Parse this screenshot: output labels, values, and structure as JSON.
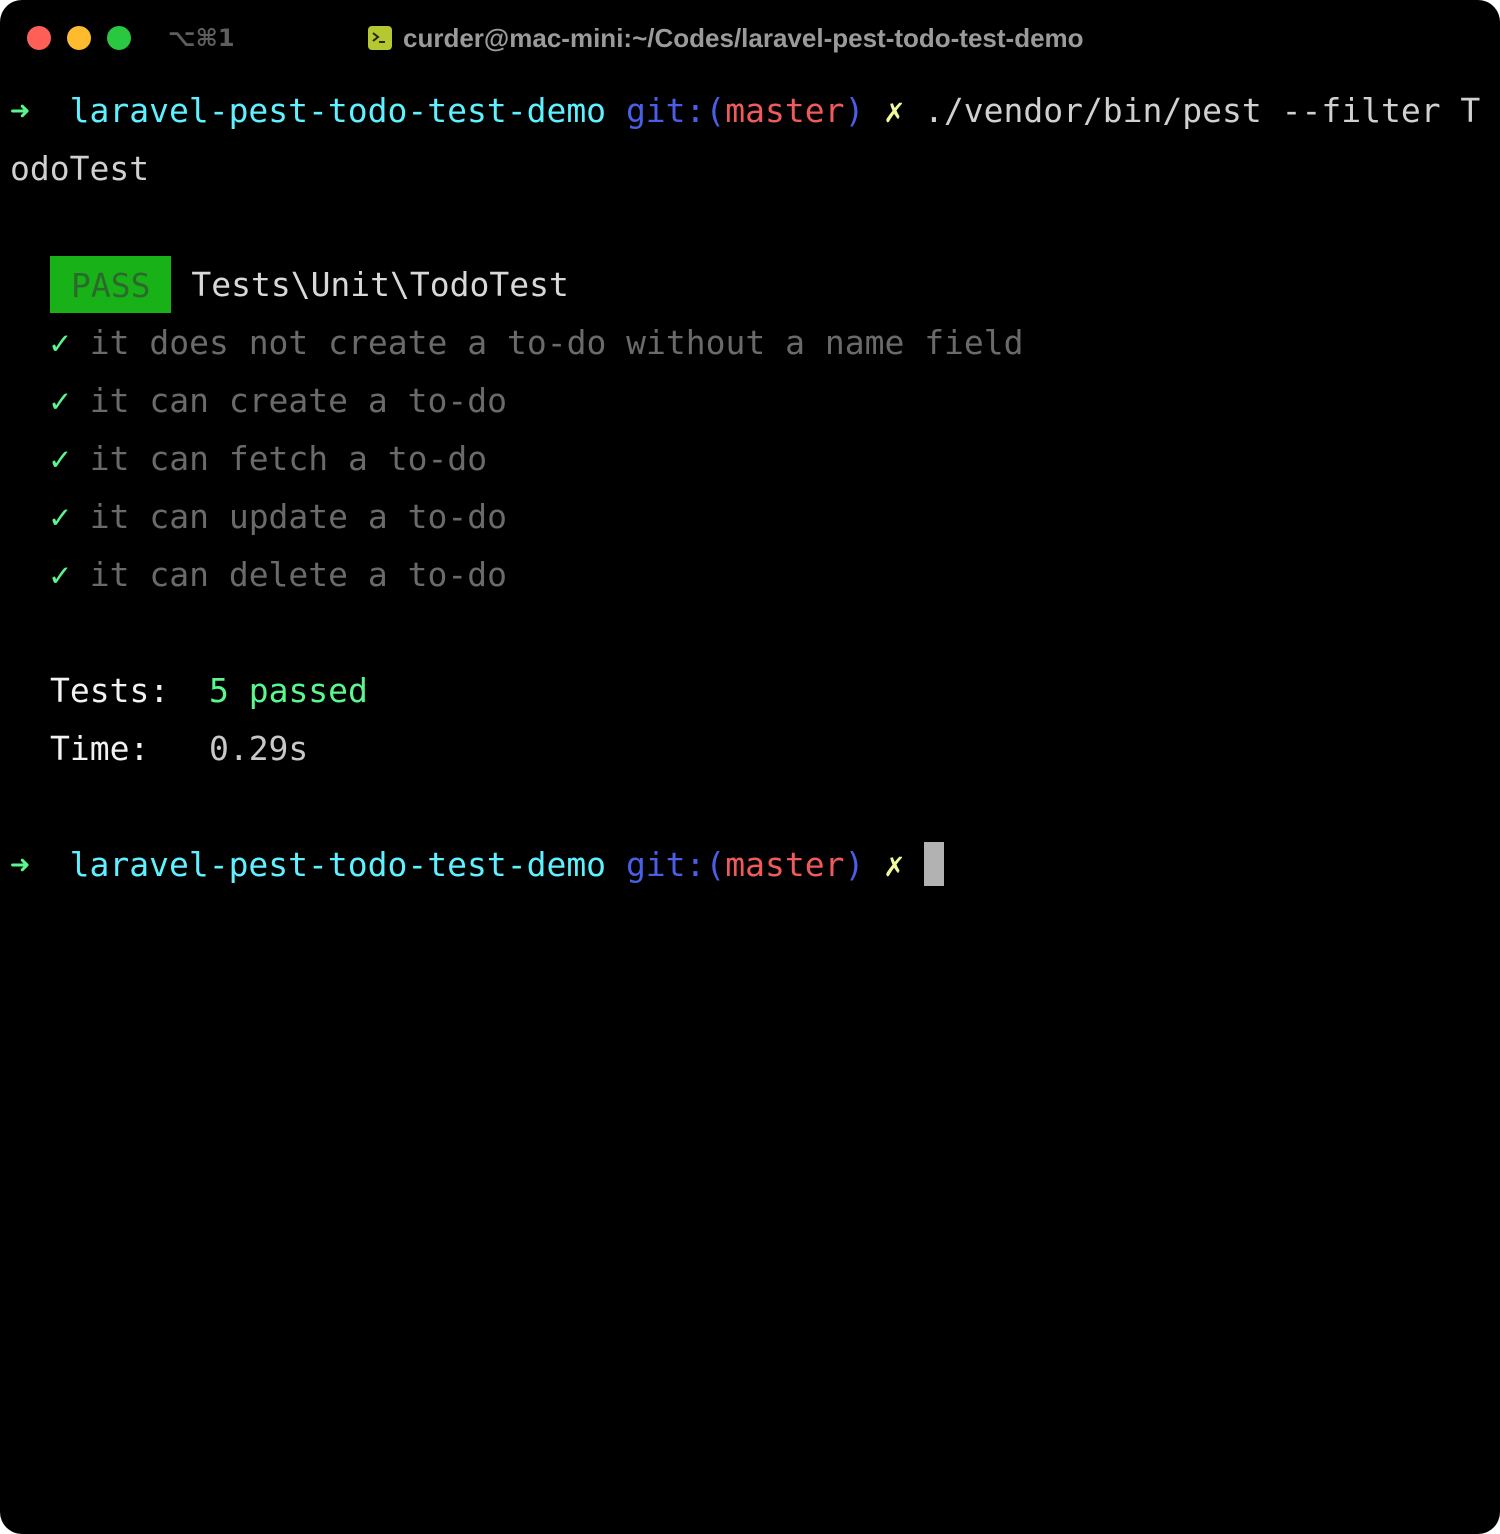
{
  "window": {
    "shortcut": "⌥⌘1",
    "title": "curder@mac-mini:~/Codes/laravel-pest-todo-test-demo"
  },
  "prompt": {
    "arrow": "➜",
    "directory": "laravel-pest-todo-test-demo",
    "git_prefix": "git:(",
    "branch": "master",
    "git_suffix": ")",
    "dirty_marker": "✗"
  },
  "command": {
    "text_line1": "./vendor/bin/pest --filter T",
    "text_line2": "odoTest"
  },
  "results": {
    "badge": "PASS",
    "suite": "Tests\\Unit\\TodoTest",
    "check_mark": "✓",
    "tests": [
      {
        "name": "it does not create a to-do without a name field"
      },
      {
        "name": "it can create a to-do"
      },
      {
        "name": "it can fetch a to-do"
      },
      {
        "name": "it can update a to-do"
      },
      {
        "name": "it can delete a to-do"
      }
    ]
  },
  "summary": {
    "tests_label": "Tests:",
    "tests_value": "5 passed",
    "time_label": "Time:",
    "time_value": "0.29s"
  },
  "colors": {
    "background": "#000000",
    "arrow": "#5af78e",
    "directory": "#5ef1ff",
    "git": "#4b5ee6",
    "branch": "#ef5a5a",
    "dirty": "#f3f99d",
    "pass_badge": "#18b218"
  },
  "icons": {
    "title_icon": "terminal-icon"
  }
}
